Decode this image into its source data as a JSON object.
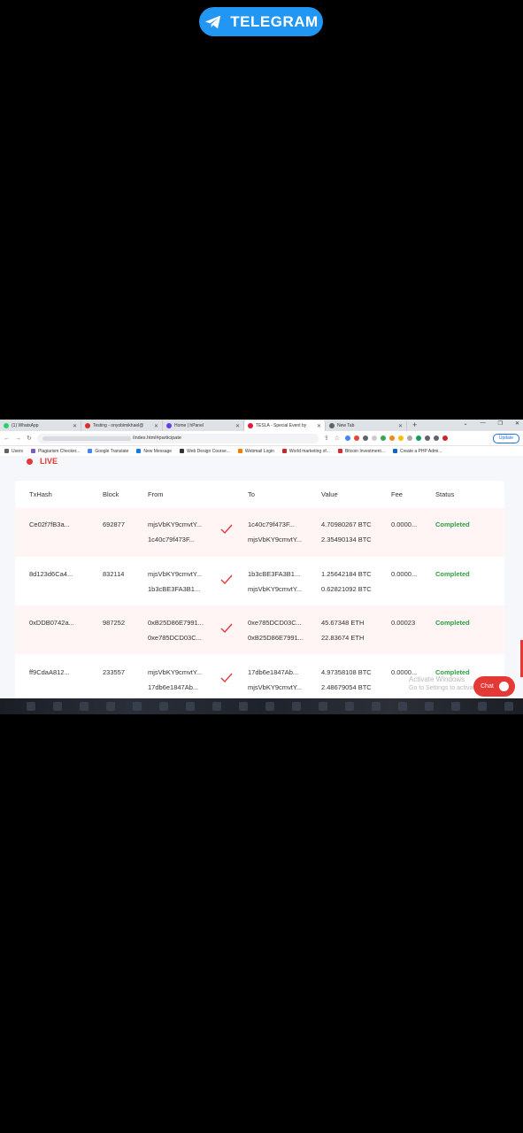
{
  "telegram": {
    "label": "TELEGRAM"
  },
  "browser": {
    "tabs": [
      {
        "title": "(1) WhatsApp",
        "color": "#25d366"
      },
      {
        "title": "Testing - onyobimikhael@",
        "color": "#d93025"
      },
      {
        "title": "Home | hPanel",
        "color": "#673de6"
      },
      {
        "title": "TESLA - Special Event by",
        "color": "#e31937"
      },
      {
        "title": "New Tab",
        "color": "#5f6368"
      }
    ],
    "url_suffix": "/index.html#participate",
    "update_label": "Update",
    "bookmarks": [
      {
        "label": "Users",
        "color": "#5f6368"
      },
      {
        "label": "Plagiarism Checker...",
        "color": "#7e57c2"
      },
      {
        "label": "Google Translate",
        "color": "#4285f4"
      },
      {
        "label": "New Message",
        "color": "#1877f2"
      },
      {
        "label": "Web Design Course...",
        "color": "#333333"
      },
      {
        "label": "Webmail Login",
        "color": "#f57c00"
      },
      {
        "label": "World marketing of...",
        "color": "#c62828"
      },
      {
        "label": "Bitcoin Investment...",
        "color": "#d32f2f"
      },
      {
        "label": "Create a PHP Admi...",
        "color": "#1565c0"
      }
    ]
  },
  "page": {
    "live_label": "LIVE",
    "columns": [
      "TxHash",
      "Block",
      "From",
      "To",
      "Value",
      "Fee",
      "Status"
    ],
    "rows": [
      {
        "hash": "Ce02f7fB3a...",
        "block": "692877",
        "from1": "mjsVbKY9cmvtY...",
        "from2": "1c40c79f473F...",
        "to1": "1c40c79f473F...",
        "to2": "mjsVbKY9cmvtY...",
        "value1": "4.70980267 BTC",
        "value2": "2.35490134 BTC",
        "fee": "0.0000...",
        "status": "Completed"
      },
      {
        "hash": "8d123d6Ca4...",
        "block": "832114",
        "from1": "mjsVbKY9cmvtY...",
        "from2": "1b3cBE3FA3B1...",
        "to1": "1b3cBE3FA3B1...",
        "to2": "mjsVbKY9cmvtY...",
        "value1": "1.25642184 BTC",
        "value2": "0.62821092 BTC",
        "fee": "0.0000...",
        "status": "Completed"
      },
      {
        "hash": "0xDDB0742a...",
        "block": "987252",
        "from1": "0xB25D86E7991...",
        "from2": "0xe785DCD03C...",
        "to1": "0xe785DCD03C...",
        "to2": "0xB25D86E7991...",
        "value1": "45.67348 ETH",
        "value2": "22.83674 ETH",
        "fee": "0.00023",
        "status": "Completed"
      },
      {
        "hash": "ff9CdaA812...",
        "block": "233557",
        "from1": "mjsVbKY9cmvtY...",
        "from2": "17db6e1847Ab...",
        "to1": "17db6e1847Ab...",
        "to2": "mjsVbKY9cmvtY...",
        "value1": "4.97358108 BTC",
        "value2": "2.48679054 BTC",
        "fee": "0.0000...",
        "status": "Completed"
      }
    ],
    "watermark_line1": "Activate Windows",
    "watermark_line2": "Go to Settings to activate Windows.",
    "chat_label": "Chat"
  },
  "colors": {
    "accent": "#e53935",
    "status": "#2e9e3f",
    "telegram": "#2196f3"
  }
}
